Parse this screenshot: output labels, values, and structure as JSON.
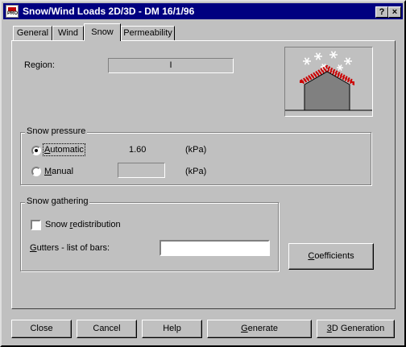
{
  "window": {
    "title": "Snow/Wind Loads 2D/3D - DM 16/1/96",
    "app_icon": "pro-app-icon",
    "help_button": "?",
    "close_button": "×"
  },
  "tabs": [
    {
      "label": "General",
      "active": false
    },
    {
      "label": "Wind",
      "active": false
    },
    {
      "label": "Snow",
      "active": true
    },
    {
      "label": "Permeability",
      "active": false
    }
  ],
  "region": {
    "label": "Region:",
    "value": "I"
  },
  "snow_pressure": {
    "group_title": "Snow pressure",
    "automatic": {
      "label_first": "A",
      "label_rest": "utomatic",
      "selected": true,
      "value": "1.60",
      "unit": "(kPa)"
    },
    "manual": {
      "label_first": "M",
      "label_rest": "anual",
      "selected": false,
      "value": "",
      "unit": "(kPa)"
    }
  },
  "snow_gathering": {
    "group_title": "Snow gathering",
    "redistribution": {
      "label_pre": "Snow ",
      "label_u": "r",
      "label_rest": "edistribution",
      "checked": false
    },
    "gutters": {
      "label_u": "G",
      "label_rest": "utters - list of bars:",
      "value": ""
    }
  },
  "buttons": {
    "coefficients": {
      "u": "C",
      "rest": "oefficients"
    },
    "close": "Close",
    "cancel": "Cancel",
    "help": "Help",
    "generate": {
      "u": "G",
      "rest": "enerate"
    },
    "generation_3d": {
      "u": "3",
      "rest": "D Generation"
    }
  },
  "colors": {
    "titlebar": "#000080",
    "roof_snow": "#cc0000",
    "building": "#808080"
  }
}
